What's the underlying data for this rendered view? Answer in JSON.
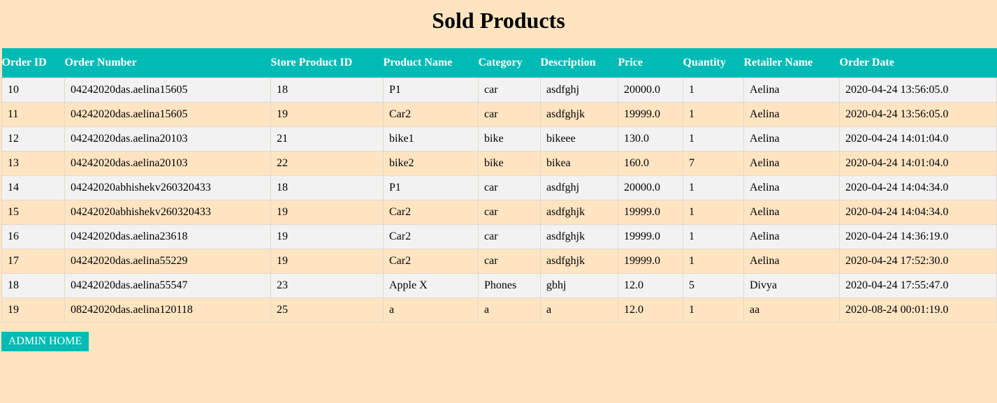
{
  "page": {
    "title": "Sold Products"
  },
  "table": {
    "headers": [
      "Order ID",
      "Order Number",
      "Store Product ID",
      "Product Name",
      "Category",
      "Description",
      "Price",
      "Quantity",
      "Retailer Name",
      "Order Date"
    ],
    "rows": [
      [
        "10",
        "04242020das.aelina15605",
        "18",
        "P1",
        "car",
        "asdfghj",
        "20000.0",
        "1",
        "Aelina",
        "2020-04-24 13:56:05.0"
      ],
      [
        "11",
        "04242020das.aelina15605",
        "19",
        "Car2",
        "car",
        "asdfghjk",
        "19999.0",
        "1",
        "Aelina",
        "2020-04-24 13:56:05.0"
      ],
      [
        "12",
        "04242020das.aelina20103",
        "21",
        "bike1",
        "bike",
        "bikeee",
        "130.0",
        "1",
        "Aelina",
        "2020-04-24 14:01:04.0"
      ],
      [
        "13",
        "04242020das.aelina20103",
        "22",
        "bike2",
        "bike",
        "bikea",
        "160.0",
        "7",
        "Aelina",
        "2020-04-24 14:01:04.0"
      ],
      [
        "14",
        "04242020abhishekv260320433",
        "18",
        "P1",
        "car",
        "asdfghj",
        "20000.0",
        "1",
        "Aelina",
        "2020-04-24 14:04:34.0"
      ],
      [
        "15",
        "04242020abhishekv260320433",
        "19",
        "Car2",
        "car",
        "asdfghjk",
        "19999.0",
        "1",
        "Aelina",
        "2020-04-24 14:04:34.0"
      ],
      [
        "16",
        "04242020das.aelina23618",
        "19",
        "Car2",
        "car",
        "asdfghjk",
        "19999.0",
        "1",
        "Aelina",
        "2020-04-24 14:36:19.0"
      ],
      [
        "17",
        "04242020das.aelina55229",
        "19",
        "Car2",
        "car",
        "asdfghjk",
        "19999.0",
        "1",
        "Aelina",
        "2020-04-24 17:52:30.0"
      ],
      [
        "18",
        "04242020das.aelina55547",
        "23",
        "Apple X",
        "Phones",
        "gbhj",
        "12.0",
        "5",
        "Divya",
        "2020-04-24 17:55:47.0"
      ],
      [
        "19",
        "08242020das.aelina120118",
        "25",
        "a",
        "a",
        "a",
        "12.0",
        "1",
        "aa",
        "2020-08-24 00:01:19.0"
      ]
    ]
  },
  "actions": {
    "admin_home_label": "ADMIN HOME"
  },
  "colors": {
    "background": "#ffe4c2",
    "accent": "#00bbb5",
    "row_alt": "#f2f2f2"
  }
}
